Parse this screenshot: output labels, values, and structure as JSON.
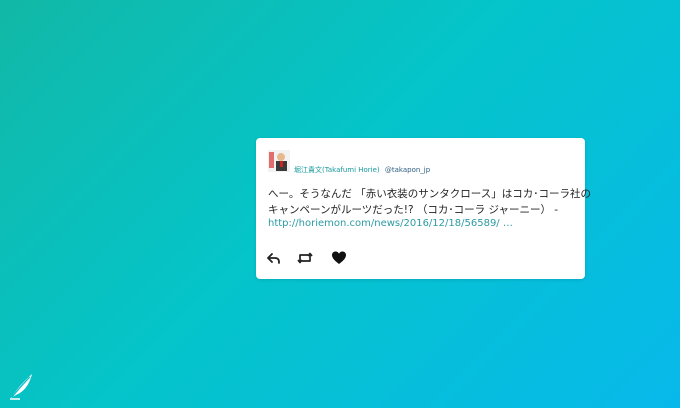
{
  "tweet": {
    "author_name": "堀江貴文(Takafumi Horie)",
    "author_handle": "@takapon_jp",
    "text_line1": "へー。そうなんだ 「赤い衣装のサンタクロース」はコカ･コーラ社の",
    "text_line2": "キャンペーンがルーツだった!? （コカ･コーラ ジャーニー） -",
    "link": "http://horiemon.com/news/2016/12/18/56589/ …"
  },
  "actions": {
    "reply": "reply-icon",
    "retweet": "retweet-icon",
    "like": "heart-icon"
  },
  "colors": {
    "accent_name": "#15999b",
    "handle": "#2f5f80",
    "link": "#2c9ba3"
  }
}
